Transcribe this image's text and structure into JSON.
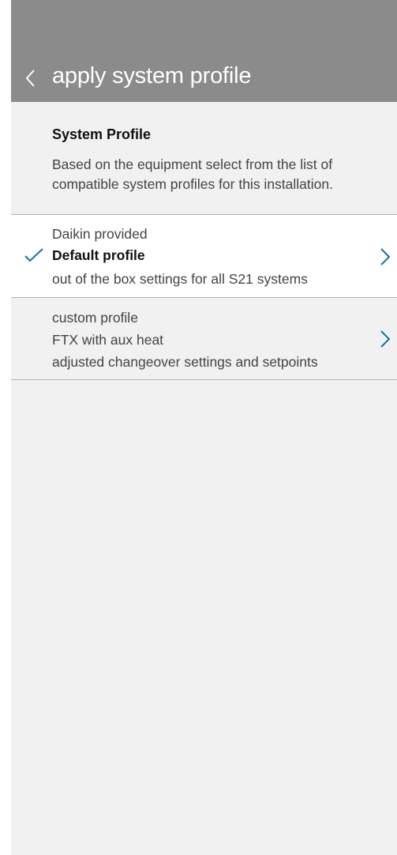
{
  "header": {
    "title": "apply system profile"
  },
  "section": {
    "title": "System  Profile",
    "description_line1": "Based on the equipment select from the list of",
    "description_line2": "compatible system profiles for this installation."
  },
  "profiles": [
    {
      "source": "Daikin provided",
      "name": "Default profile",
      "description": "out of the box settings for all S21 systems",
      "selected": true
    },
    {
      "source": "custom profile",
      "name": "FTX with aux heat",
      "description": "adjusted changeover settings and setpoints",
      "selected": false
    }
  ],
  "colors": {
    "header_bg": "#8b8b8b",
    "background": "#f1f1f1",
    "accent": "#1f6f9c",
    "divider": "#b4b4b4"
  },
  "icons": {
    "back": "chevron-left-icon",
    "selected": "checkmark-icon",
    "row_action": "chevron-right-icon"
  }
}
